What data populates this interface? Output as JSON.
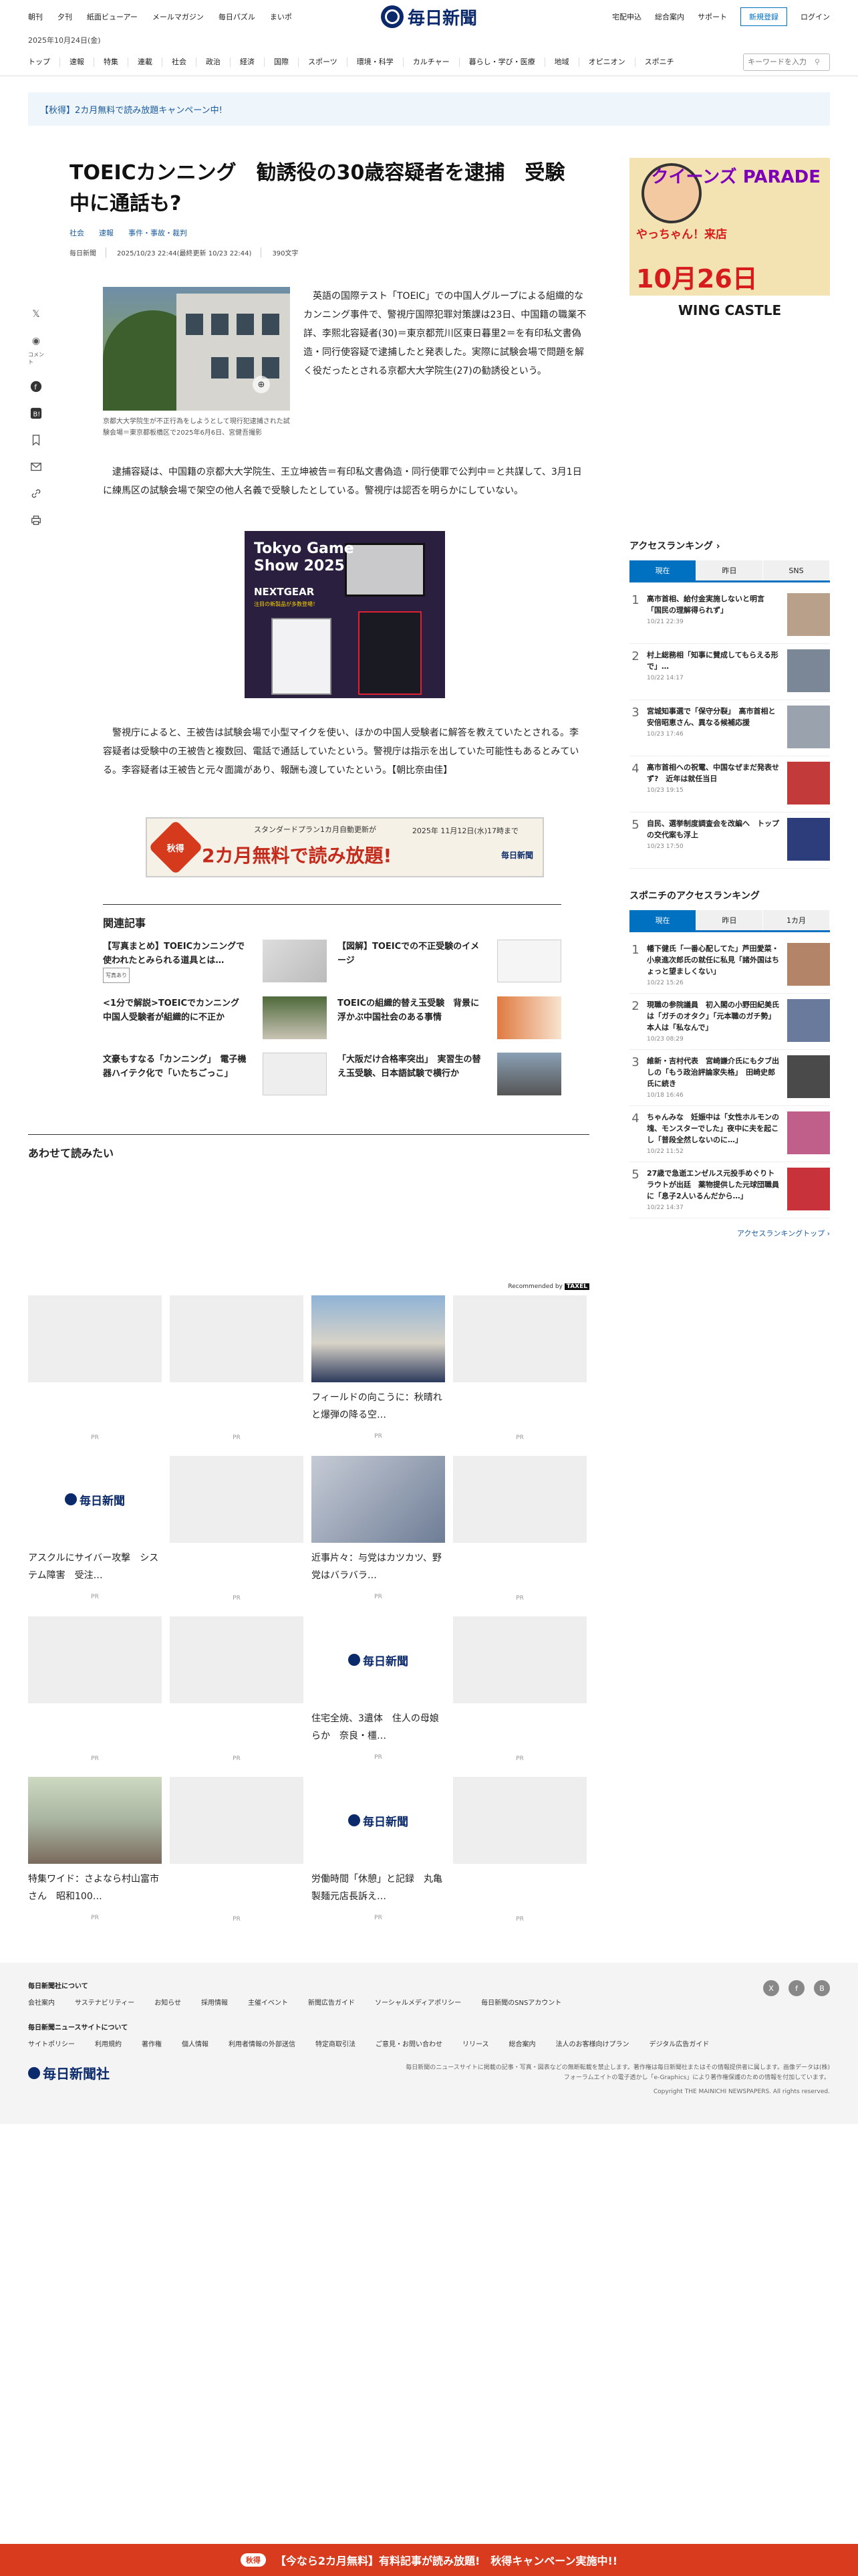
{
  "header": {
    "left_links": [
      "朝刊",
      "夕刊",
      "紙面ビューアー",
      "メールマガジン",
      "毎日パズル",
      "まいポ"
    ],
    "logo": "毎日新聞",
    "right_links": [
      "宅配申込",
      "総合案内",
      "サポート"
    ],
    "register": "新規登録",
    "login": "ログイン",
    "date": "2025年10月24日(金)"
  },
  "nav": {
    "items": [
      "トップ",
      "速報",
      "特集",
      "連載",
      "社会",
      "政治",
      "経済",
      "国際",
      "スポーツ",
      "環境・科学",
      "カルチャー",
      "暮らし・学び・医療",
      "地域",
      "オピニオン",
      "スポニチ"
    ],
    "search_placeholder": "キーワードを入力"
  },
  "campaign": {
    "text": "【秋得】2カ月無料で読み放題キャンペーン中!"
  },
  "article": {
    "title": "TOEICカンニング　勧誘役の30歳容疑者を逮捕　受験中に通話も?",
    "tags": [
      "社会",
      "速報",
      "事件・事故・裁判"
    ],
    "source": "毎日新聞",
    "date": "2025/10/23 22:44(最終更新 10/23 22:44)",
    "chars": "390文字",
    "photo_caption": "京都大大学院生が不正行為をしようとして現行犯逮捕された試験会場＝東京都板橋区で2025年6月6日、宮健吾撮影",
    "para1": "英語の国際テスト「TOEIC」での中国人グループによる組織的なカンニング事件で、警視庁国際犯罪対策課は23日、中国籍の職業不詳、李熙北容疑者(30)＝東京都荒川区東日暮里2＝を有印私文書偽造・同行使容疑で逮捕したと発表した。実際に試験会場で問題を解く役だったとされる京都大大学院生(27)の勧誘役という。",
    "para2": "逮捕容疑は、中国籍の京都大大学院生、王立坤被告＝有印私文書偽造・同行使罪で公判中＝と共謀して、3月1日に練馬区の試験会場で架空の他人名義で受験したとしている。警視庁は認否を明らかにしていない。",
    "para3": "警視庁によると、王被告は試験会場で小型マイクを使い、ほかの中国人受験者に解答を教えていたとされる。李容疑者は受験中の王被告と複数回、電話で通話していたという。警視庁は指示を出していた可能性もあるとみている。李容疑者は王被告と元々面識があり、報酬も渡していたという。【朝比奈由佳】"
  },
  "share": {
    "comment_label": "コメント"
  },
  "ads": {
    "mid_title": "Tokyo Game Show 2025",
    "mid_sub": "NEXTGEAR",
    "mid_note": "注目の新製品が多数登場！",
    "promo_sub": "スタンダードプラン1カ月自動更新が",
    "promo_date": "2025年 11月12日(水)17時まで",
    "promo_main": "2カ月無料で読み放題!",
    "promo_leaf": "秋得",
    "promo_logo": "毎日新聞",
    "side_head": "クイーンズ PARADE",
    "side_yac": "やっちゃん！来店",
    "side_big": "10月26日",
    "side_brand": "WING CASTLE"
  },
  "related": {
    "heading": "関連記事",
    "items": [
      {
        "text": "【写真まとめ】TOEICカンニングで使われたとみられる道具とは…",
        "badge": "写真あり"
      },
      {
        "text": "【図解】TOEICでの不正受験のイメージ",
        "badge": ""
      },
      {
        "text": "<1分で解説>TOEICでカンニング　中国人受験者が組織的に不正か",
        "badge": ""
      },
      {
        "text": "TOEICの組織的替え玉受験　背景に浮かぶ中国社会のある事情",
        "badge": ""
      },
      {
        "text": "文豪もすなる「カンニング」　電子機器ハイテク化で「いたちごっこ」",
        "badge": ""
      },
      {
        "text": "「大阪だけ合格率突出」　実習生の替え玉受験、日本語試験で横行か",
        "badge": ""
      }
    ]
  },
  "awase": {
    "heading": "あわせて読みたい",
    "recommended_by": "Recommended by",
    "pr": "PR",
    "cards": [
      {
        "title": "",
        "type": "blank"
      },
      {
        "title": "",
        "type": "blank"
      },
      {
        "title": "フィールドの向こうに：秋晴れと爆弾の降る空…",
        "type": "photo"
      },
      {
        "title": "",
        "type": "blank"
      },
      {
        "title": "アスクルにサイバー攻撃　システム障害　受注…",
        "type": "logo"
      },
      {
        "title": "",
        "type": "blank"
      },
      {
        "title": "近事片々：与党はカツカツ、野党はバラバラ…",
        "type": "photo2"
      },
      {
        "title": "",
        "type": "blank"
      },
      {
        "title": "",
        "type": "blank"
      },
      {
        "title": "",
        "type": "blank"
      },
      {
        "title": "住宅全焼、3遺体　住人の母娘らか　奈良・橿…",
        "type": "logo"
      },
      {
        "title": "",
        "type": "blank"
      },
      {
        "title": "特集ワイド：さよなら村山富市さん　昭和100…",
        "type": "photo3"
      },
      {
        "title": "",
        "type": "blank"
      },
      {
        "title": "労働時間「休憩」と記録　丸亀製麺元店長訴え…",
        "type": "logo"
      },
      {
        "title": "",
        "type": "blank"
      }
    ]
  },
  "ranking": {
    "heading": "アクセスランキング",
    "tabs": [
      "現在",
      "昨日",
      "SNS"
    ],
    "items": [
      {
        "text": "高市首相、給付金実施しないと明言　「国民の理解得られず」",
        "date": "10/21 22:39"
      },
      {
        "text": "村上総務相「知事に賛成してもらえる形で」…",
        "date": "10/22 14:17"
      },
      {
        "text": "宮城知事選で「保守分裂」　高市首相と安倍昭恵さん、異なる候補応援",
        "date": "10/23 17:46"
      },
      {
        "text": "高市首相への祝電、中国なぜまだ発表せず?　近年は就任当日",
        "date": "10/23 19:15"
      },
      {
        "text": "自民、選挙制度調査会を改編へ　トップの交代案も浮上",
        "date": "10/23 17:50"
      }
    ],
    "more": "アクセスランキングトップ"
  },
  "ranking2": {
    "heading": "スポニチのアクセスランキング",
    "tabs": [
      "現在",
      "昨日",
      "1カ月"
    ],
    "items": [
      {
        "text": "幡下健氏「一番心配してた」芦田愛菜・小泉進次郎氏の就任に私見「諸外国はちょっと望ましくない」",
        "date": "10/22 15:26"
      },
      {
        "text": "現職の参院議員　初入閣の小野田紀美氏は「ガチのオタク」「元本職のガチ勢」本人は「私なんで」",
        "date": "10/23 08:29"
      },
      {
        "text": "維新・吉村代表　宮崎謙介氏にも夕ブ出しの「もう政治評論家失格」　田崎史郎氏に続き",
        "date": "10/18 16:46"
      },
      {
        "text": "ちゃんみな　妊娠中は「女性ホルモンの塊、モンスターでした」夜中に夫を起こし「普段全然しないのに…」",
        "date": "10/22 11:52"
      },
      {
        "text": "27歳で急逝エンゼルス元投手めぐりトラウトが出廷　薬物提供した元球団職員に「息子2人いるんだから…」",
        "date": "10/22 14:37"
      }
    ]
  },
  "footer": {
    "about_heading": "毎日新聞社について",
    "about_links": [
      "会社案内",
      "サステナビリティー",
      "お知らせ",
      "採用情報",
      "主催イベント",
      "新聞広告ガイド",
      "ソーシャルメディアポリシー",
      "毎日新聞のSNSアカウント"
    ],
    "site_heading": "毎日新聞ニュースサイトについて",
    "site_links": [
      "サイトポリシー",
      "利用規約",
      "著作権",
      "個人情報",
      "利用者情報の外部送信",
      "特定商取引法",
      "ご意見・お問い合わせ",
      "リリース",
      "総合案内",
      "法人のお客様向けプラン",
      "デジタル広告ガイド"
    ],
    "logo": "毎日新聞社",
    "note": "毎日新聞のニュースサイトに掲載の記事・写真・図表などの無断転載を禁止します。著作権は毎日新聞社またはその情報提供者に属します。画像データは(株)フォーラムエイトの電子透かし「e-Graphics」により著作権保護のための情報を付加しています。",
    "copyright": "Copyright THE MAINICHI NEWSPAPERS. All rights reserved."
  },
  "bottom_bar": {
    "pill": "秋得",
    "text": "【今なら2カ月無料】有料記事が読み放題!　秋得キャンペーン実施中!!"
  }
}
